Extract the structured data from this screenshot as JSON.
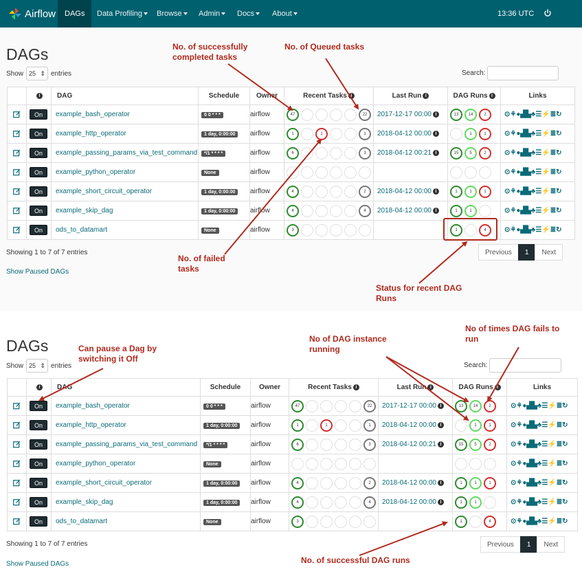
{
  "navbar": {
    "brand": "Airflow",
    "items": [
      "DAGs",
      "Data Profiling",
      "Browse",
      "Admin",
      "Docs",
      "About"
    ],
    "time": "13:36 UTC"
  },
  "page": {
    "title": "DAGs",
    "show_label": "Show",
    "entries_value": "25",
    "entries_label": "entries",
    "search_label": "Search:",
    "showing": "Showing 1 to 7 of 7 entries",
    "show_paused": "Show Paused DAGs",
    "pager": {
      "prev": "Previous",
      "current": "1",
      "next": "Next"
    }
  },
  "table": {
    "headers": {
      "dag": "DAG",
      "schedule": "Schedule",
      "owner": "Owner",
      "recent_tasks": "Recent Tasks",
      "last_run": "Last Run",
      "dag_runs": "DAG Runs",
      "links": "Links"
    },
    "toggle_label": "On",
    "links_glyphs": "⊙⚘●▟▙♣☰⚡≣↻",
    "rows": [
      {
        "dag": "example_bash_operator",
        "schedule": "0 0 * * *",
        "owner": "airflow",
        "tasks": [
          {
            "s": "success",
            "v": "47"
          },
          {
            "s": "",
            "v": ""
          },
          {
            "s": "",
            "v": ""
          },
          {
            "s": "",
            "v": ""
          },
          {
            "s": "",
            "v": ""
          },
          {
            "s": "queued",
            "v": "22"
          }
        ],
        "last_run": "2017-12-17 00:00",
        "runs": [
          {
            "s": "success",
            "v": "13"
          },
          {
            "s": "running",
            "v": "14"
          },
          {
            "s": "failed",
            "v": "2"
          }
        ]
      },
      {
        "dag": "example_http_operator",
        "schedule": "1 day, 0:00:00",
        "owner": "airflow",
        "tasks": [
          {
            "s": "success",
            "v": "1"
          },
          {
            "s": "",
            "v": ""
          },
          {
            "s": "failed",
            "v": "1"
          },
          {
            "s": "",
            "v": ""
          },
          {
            "s": "",
            "v": ""
          },
          {
            "s": "queued",
            "v": "1"
          }
        ],
        "last_run": "2018-04-12 00:00",
        "runs": [
          {
            "s": "",
            "v": ""
          },
          {
            "s": "running",
            "v": "1"
          },
          {
            "s": "failed",
            "v": "1"
          }
        ]
      },
      {
        "dag": "example_passing_params_via_test_command",
        "schedule": "*/1 * * * *",
        "owner": "airflow",
        "tasks": [
          {
            "s": "success",
            "v": "6"
          },
          {
            "s": "",
            "v": ""
          },
          {
            "s": "",
            "v": ""
          },
          {
            "s": "",
            "v": ""
          },
          {
            "s": "",
            "v": ""
          },
          {
            "s": "queued",
            "v": "3"
          }
        ],
        "last_run": "2018-04-12 00:21",
        "runs": [
          {
            "s": "success",
            "v": "15"
          },
          {
            "s": "running",
            "v": "5"
          },
          {
            "s": "failed",
            "v": "2"
          }
        ]
      },
      {
        "dag": "example_python_operator",
        "schedule": "None",
        "owner": "airflow",
        "tasks": [
          {
            "s": "",
            "v": ""
          },
          {
            "s": "",
            "v": ""
          },
          {
            "s": "",
            "v": ""
          },
          {
            "s": "",
            "v": ""
          },
          {
            "s": "",
            "v": ""
          },
          {
            "s": "",
            "v": ""
          }
        ],
        "last_run": "",
        "runs": [
          {
            "s": "",
            "v": ""
          },
          {
            "s": "",
            "v": ""
          },
          {
            "s": "",
            "v": ""
          }
        ]
      },
      {
        "dag": "example_short_circuit_operator",
        "schedule": "1 day, 0:00:00",
        "owner": "airflow",
        "tasks": [
          {
            "s": "success",
            "v": "4"
          },
          {
            "s": "",
            "v": ""
          },
          {
            "s": "",
            "v": ""
          },
          {
            "s": "",
            "v": ""
          },
          {
            "s": "",
            "v": ""
          },
          {
            "s": "queued",
            "v": "2"
          }
        ],
        "last_run": "2018-04-12 00:00",
        "runs": [
          {
            "s": "success",
            "v": "1"
          },
          {
            "s": "running",
            "v": "1"
          },
          {
            "s": "failed",
            "v": "1"
          }
        ]
      },
      {
        "dag": "example_skip_dag",
        "schedule": "1 day, 0:00:00",
        "owner": "airflow",
        "tasks": [
          {
            "s": "success",
            "v": "4"
          },
          {
            "s": "",
            "v": ""
          },
          {
            "s": "",
            "v": ""
          },
          {
            "s": "",
            "v": ""
          },
          {
            "s": "",
            "v": ""
          },
          {
            "s": "queued",
            "v": "4"
          }
        ],
        "last_run": "2018-04-12 00:00",
        "runs": [
          {
            "s": "success",
            "v": "1"
          },
          {
            "s": "running",
            "v": "1"
          },
          {
            "s": "",
            "v": ""
          }
        ]
      },
      {
        "dag": "ods_to_datamart",
        "schedule": "None",
        "owner": "airflow",
        "tasks": [
          {
            "s": "success",
            "v": "3"
          },
          {
            "s": "",
            "v": ""
          },
          {
            "s": "",
            "v": ""
          },
          {
            "s": "",
            "v": ""
          },
          {
            "s": "",
            "v": ""
          },
          {
            "s": "",
            "v": ""
          }
        ],
        "last_run": "",
        "runs": [
          {
            "s": "success",
            "v": "1"
          },
          {
            "s": "",
            "v": ""
          },
          {
            "s": "failed",
            "v": "4"
          }
        ]
      }
    ]
  },
  "annotations": {
    "successful_tasks": "No. of successfully completed tasks",
    "queued_tasks": "No. of Queued tasks",
    "failed_tasks": "No. of failed tasks",
    "recent_dag_runs": "Status for recent DAG Runs",
    "pause_dag": "Can pause a Dag by switching it Off",
    "running_instances": "No of DAG instance running",
    "dag_fails": "No of times DAG fails to run",
    "successful_runs": "No. of successful DAG runs"
  },
  "colors": {
    "navbar": "#00606e",
    "success": "#2e8b2e",
    "failed": "#d32f2f",
    "queued": "#777777",
    "running": "#62d962",
    "annotation": "#b02a1e"
  }
}
